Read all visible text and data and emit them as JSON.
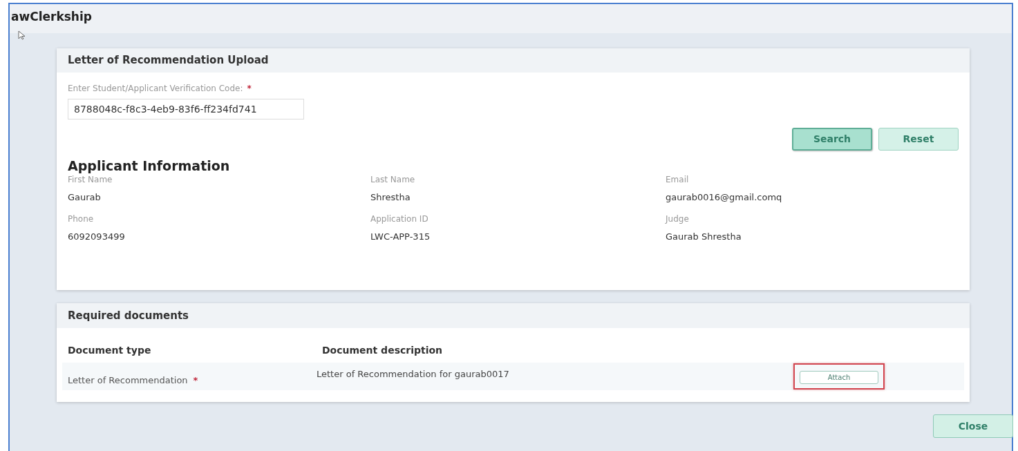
{
  "window": {
    "title": "awClerkship"
  },
  "upload": {
    "title": "Letter of Recommendation Upload",
    "code_field": {
      "label": "Enter Student/Applicant Verification Code:",
      "required_mark": "*",
      "value": "8788048c-f8c3-4eb9-83f6-ff234fd741"
    },
    "buttons": [
      {
        "label": "Search",
        "kind": "primary"
      },
      {
        "label": "Reset",
        "kind": "secondary"
      }
    ]
  },
  "applicant": {
    "title": "Applicant Information",
    "fields": [
      {
        "label": "First Name",
        "value": "Gaurab"
      },
      {
        "label": "Last Name",
        "value": "Shrestha"
      },
      {
        "label": "Email",
        "value": "gaurab0016@gmail.comq"
      },
      {
        "label": "Phone",
        "value": "6092093499"
      },
      {
        "label": "Application ID",
        "value": "LWC-APP-315"
      },
      {
        "label": "Judge",
        "value": "Gaurab Shrestha"
      }
    ]
  },
  "documents": {
    "title": "Required documents",
    "columns": [
      "Document type",
      "Document description"
    ],
    "rows": [
      {
        "type": "Letter of Recommendation",
        "required_mark": "*",
        "description": "Letter of Recommendation for gaurab0017",
        "action": {
          "label": "Attach",
          "highlighted": true
        }
      }
    ]
  },
  "footer_button": "Close"
}
